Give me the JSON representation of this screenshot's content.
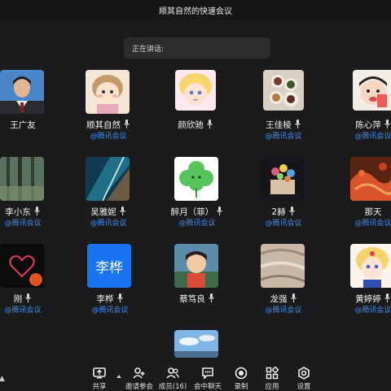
{
  "meeting": {
    "title": "顺其自然的快速会议",
    "speaking_label": "正在讲话:"
  },
  "participants": [
    {
      "name": "王广友",
      "sub": "",
      "mic": false,
      "avatar_icon": "person-photo-icon"
    },
    {
      "name": "顺其自然",
      "sub": "@腾讯会议",
      "mic": true,
      "avatar_icon": "cartoon-girl-icon"
    },
    {
      "name": "颜欣驰",
      "sub": "",
      "mic": true,
      "avatar_icon": "anime-girl-icon"
    },
    {
      "name": "王佳棱",
      "sub": "@腾讯会议",
      "mic": true,
      "avatar_icon": "food-photo-icon"
    },
    {
      "name": "陈心萍",
      "sub": "@腾讯会议",
      "mic": true,
      "avatar_icon": "cartoon-kid-icon"
    },
    {
      "name": "李小东",
      "sub": "@腾讯会议",
      "mic": true,
      "avatar_icon": "forest-photo-icon"
    },
    {
      "name": "吴雅妮",
      "sub": "@腾讯会议",
      "mic": true,
      "avatar_icon": "coast-photo-icon"
    },
    {
      "name": "醉月（菲）",
      "sub": "@腾讯会议",
      "mic": true,
      "avatar_icon": "clover-icon"
    },
    {
      "name": "2赫",
      "sub": "@腾讯会议",
      "mic": true,
      "avatar_icon": "cake-photo-icon"
    },
    {
      "name": "那天",
      "sub": "@腾讯会议",
      "mic": false,
      "avatar_icon": "seafood-photo-icon"
    },
    {
      "name": "刚",
      "sub": "@腾讯会议",
      "mic": true,
      "avatar_icon": "heart-icon"
    },
    {
      "name": "李桦",
      "sub": "@腾讯会议",
      "mic": true,
      "avatar_icon": "name-avatar-icon",
      "avatar_text": "李桦"
    },
    {
      "name": "蔡笃良",
      "sub": "",
      "mic": true,
      "avatar_icon": "anime-boy-icon"
    },
    {
      "name": "龙强",
      "sub": "@腾讯会议",
      "mic": true,
      "avatar_icon": "texture-photo-icon"
    },
    {
      "name": "黄婷婷",
      "sub": "@腾讯会议",
      "mic": true,
      "avatar_icon": "sailor-girl-icon"
    },
    {
      "name": "",
      "sub": "",
      "mic": false,
      "avatar_icon": "sky-photo-icon"
    }
  ],
  "toolbar": [
    {
      "label": "共享",
      "icon": "share-screen-icon"
    },
    {
      "label": "邀请参会",
      "icon": "invite-icon"
    },
    {
      "label": "成员(16)",
      "icon": "members-icon"
    },
    {
      "label": "会中聊天",
      "icon": "chat-icon"
    },
    {
      "label": "录制",
      "icon": "record-icon"
    },
    {
      "label": "应用",
      "icon": "apps-icon"
    },
    {
      "label": "设置",
      "icon": "settings-icon"
    }
  ],
  "colors": {
    "background": "#1b1b1d",
    "link_blue": "#3d8df0",
    "name_avatar_blue": "#1a73f0"
  }
}
